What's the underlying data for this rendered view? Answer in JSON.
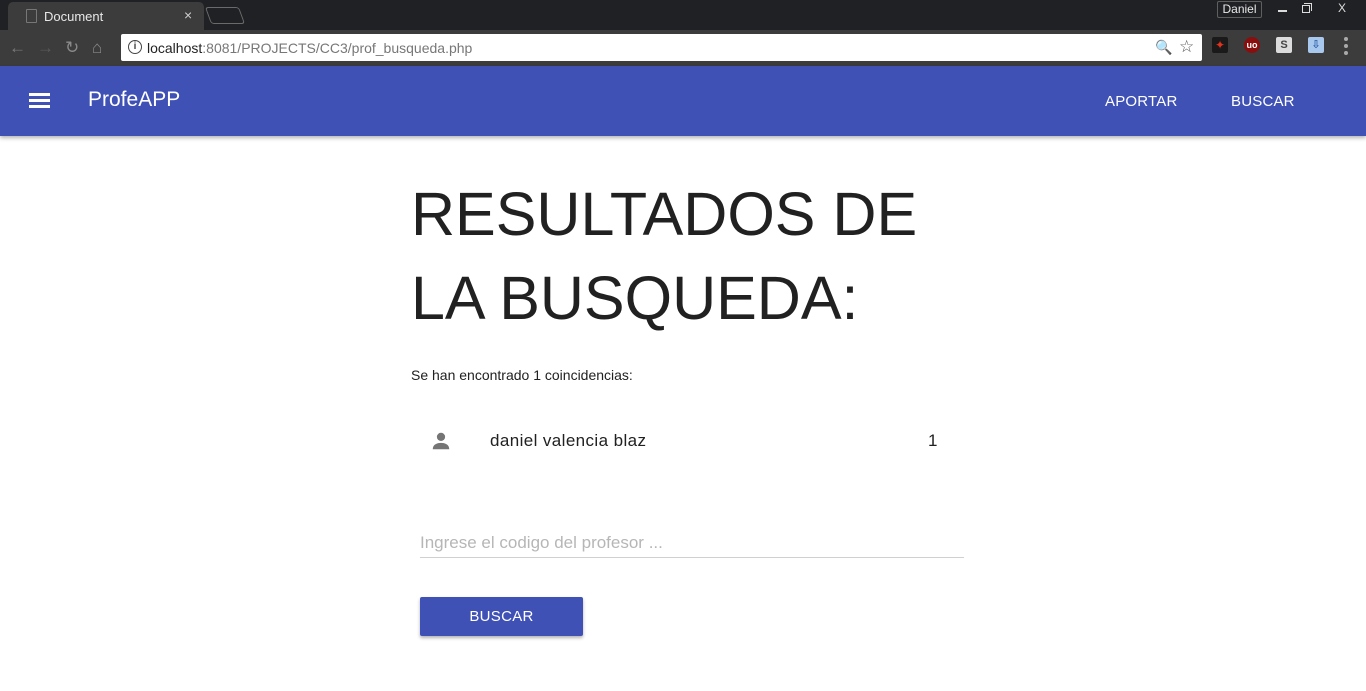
{
  "browser": {
    "tab_title": "Document",
    "tab_close": "×",
    "profile_name": "Daniel",
    "window_close": "X",
    "url_host": "localhost",
    "url_rest": ":8081/PROJECTS/CC3/prof_busqueda.php",
    "extensions": [
      "pdf-icon",
      "ublock-icon",
      "s-extension-icon",
      "download-extension-icon"
    ],
    "ext_ub_label": "uo",
    "ext_s_label": "S"
  },
  "appbar": {
    "title": "ProfeAPP",
    "nav": {
      "aportar": "APORTAR",
      "buscar": "BUSCAR"
    },
    "color": "#3f51b5"
  },
  "main": {
    "title": "RESULTADOS DE LA BUSQUEDA:",
    "count_text": "Se han encontrado 1 coincidencias:",
    "results": [
      {
        "name": "daniel valencia blaz",
        "code": "1",
        "icon": "person-icon"
      }
    ],
    "search": {
      "placeholder": "Ingrese el codigo del profesor ...",
      "value": ""
    },
    "button_label": "BUSCAR"
  }
}
